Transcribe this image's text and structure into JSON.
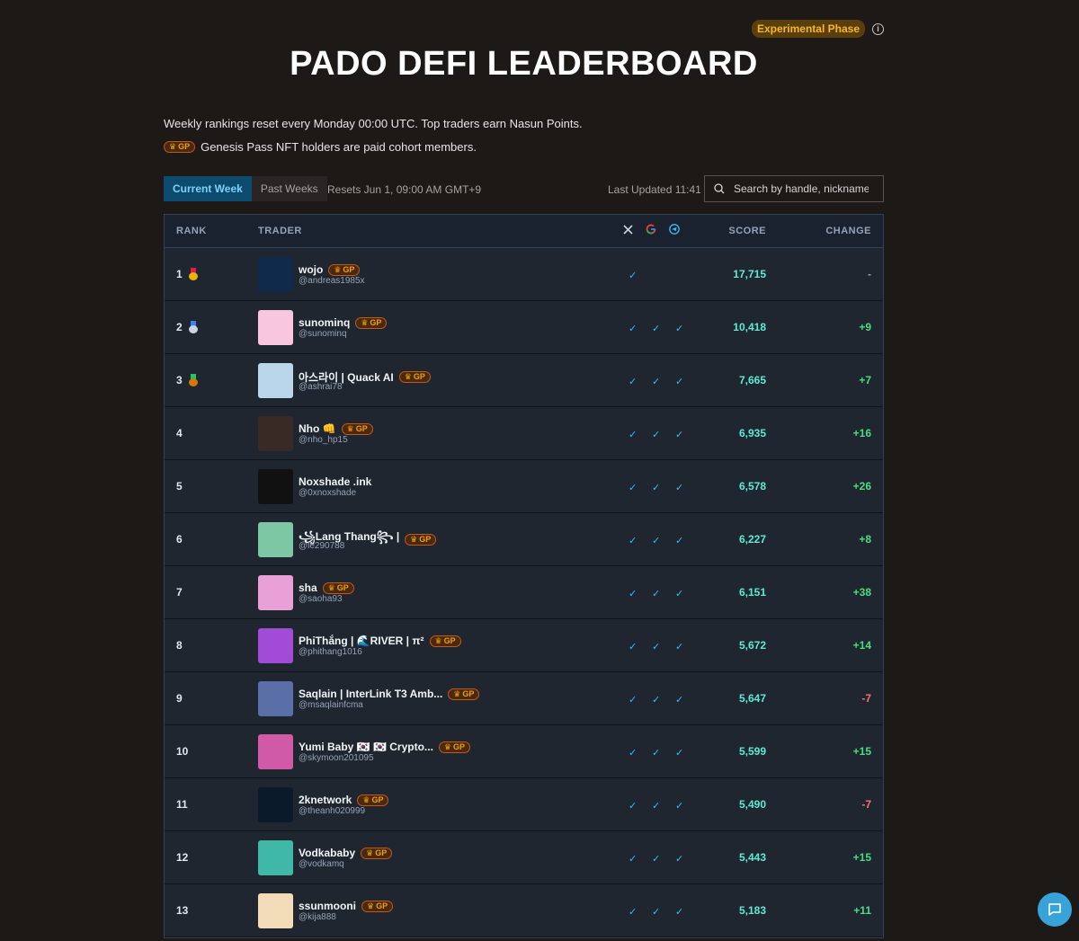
{
  "header": {
    "phase_badge": "Experimental Phase",
    "info_glyph": "i",
    "title": "PADO DEFI LEADERBOARD",
    "intro_line1": "Weekly rankings reset every Monday 00:00 UTC. Top traders earn Nasun Points.",
    "intro_line2": "Genesis Pass NFT holders are paid cohort members."
  },
  "gp_label": "GP",
  "controls": {
    "tabs": [
      {
        "label": "Current Week",
        "active": true
      },
      {
        "label": "Past Weeks",
        "active": false
      }
    ],
    "resets": "Resets Jun 1, 09:00 AM GMT+9",
    "last_updated": "Last Updated 11:41",
    "search_placeholder": "Search by handle, nickname"
  },
  "table": {
    "headers": {
      "rank": "RANK",
      "trader": "TRADER",
      "score": "SCORE",
      "change": "CHANGE"
    },
    "social_icons": [
      "x-icon",
      "google-icon",
      "telegram-icon"
    ],
    "rows": [
      {
        "rank": "1",
        "medal": "gold",
        "name": "wojo",
        "gp": true,
        "handle": "@andreas1985x",
        "x": true,
        "google": false,
        "telegram": false,
        "score": "17,715",
        "change": "-",
        "trend": "neutral",
        "avatar_color": "#0f2a4a"
      },
      {
        "rank": "2",
        "medal": "silver",
        "name": "sunominq",
        "gp": true,
        "handle": "@sunominq",
        "x": true,
        "google": true,
        "telegram": true,
        "score": "10,418",
        "change": "+9",
        "trend": "pos",
        "avatar_color": "#f9c6e0"
      },
      {
        "rank": "3",
        "medal": "bronze",
        "name": "아스라이 | Quack AI",
        "gp": true,
        "handle": "@ashrai78",
        "x": true,
        "google": true,
        "telegram": true,
        "score": "7,665",
        "change": "+7",
        "trend": "pos",
        "avatar_color": "#b9d6ea"
      },
      {
        "rank": "4",
        "medal": "",
        "name": "Nho 👊",
        "gp": true,
        "handle": "@nho_hp15",
        "x": true,
        "google": true,
        "telegram": true,
        "score": "6,935",
        "change": "+16",
        "trend": "pos",
        "avatar_color": "#3a2a26"
      },
      {
        "rank": "5",
        "medal": "",
        "name": "Noxshade .ink",
        "gp": false,
        "handle": "@0xnoxshade",
        "x": true,
        "google": true,
        "telegram": true,
        "score": "6,578",
        "change": "+26",
        "trend": "pos",
        "avatar_color": "#111111"
      },
      {
        "rank": "6",
        "medal": "",
        "name": "꧁Lang Thang꧂ |",
        "gp": true,
        "handle": "@le290788",
        "x": true,
        "google": true,
        "telegram": true,
        "score": "6,227",
        "change": "+8",
        "trend": "pos",
        "avatar_color": "#7ec7a4"
      },
      {
        "rank": "7",
        "medal": "",
        "name": "sha",
        "gp": true,
        "handle": "@saoha93",
        "x": true,
        "google": true,
        "telegram": true,
        "score": "6,151",
        "change": "+38",
        "trend": "pos",
        "avatar_color": "#e8a0d6"
      },
      {
        "rank": "8",
        "medal": "",
        "name": "PhiThắng | 🌊RIVER | π²",
        "gp": true,
        "handle": "@phithang1016",
        "x": true,
        "google": true,
        "telegram": true,
        "score": "5,672",
        "change": "+14",
        "trend": "pos",
        "avatar_color": "#a24bd6"
      },
      {
        "rank": "9",
        "medal": "",
        "name": "Saqlain | InterLink T3 Amb...",
        "gp": true,
        "handle": "@msaqlainfcma",
        "x": true,
        "google": true,
        "telegram": true,
        "score": "5,647",
        "change": "-7",
        "trend": "neg",
        "avatar_color": "#5a6fa8"
      },
      {
        "rank": "10",
        "medal": "",
        "name": "Yumi Baby 🇰🇷 🇰🇷 Crypto...",
        "gp": true,
        "handle": "@skymoon201095",
        "x": true,
        "google": true,
        "telegram": true,
        "score": "5,599",
        "change": "+15",
        "trend": "pos",
        "avatar_color": "#d05aa8"
      },
      {
        "rank": "11",
        "medal": "",
        "name": "2knetwork",
        "gp": true,
        "handle": "@theanh020999",
        "x": true,
        "google": true,
        "telegram": true,
        "score": "5,490",
        "change": "-7",
        "trend": "neg",
        "avatar_color": "#0b1a2a"
      },
      {
        "rank": "12",
        "medal": "",
        "name": "Vodkababy",
        "gp": true,
        "handle": "@vodkamq",
        "x": true,
        "google": true,
        "telegram": true,
        "score": "5,443",
        "change": "+15",
        "trend": "pos",
        "avatar_color": "#3fb8a8"
      },
      {
        "rank": "13",
        "medal": "",
        "name": "ssunmooni",
        "gp": true,
        "handle": "@kija888",
        "x": true,
        "google": true,
        "telegram": true,
        "score": "5,183",
        "change": "+11",
        "trend": "pos",
        "avatar_color": "#f2dcb8"
      }
    ]
  },
  "chat_button_icon": "chat-bubble-icon",
  "colors": {
    "accent": "#38bdf8",
    "score": "#5eead4",
    "positive": "#4ade80",
    "negative": "#f87171",
    "gp_badge": "#f59e0b",
    "phase_badge": "#f5b820"
  }
}
